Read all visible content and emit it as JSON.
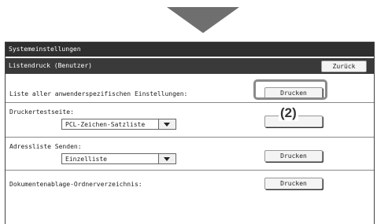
{
  "window": {
    "title": "Systemeinstellungen"
  },
  "header": {
    "title": "Listendruck (Benutzer)",
    "back_label": "Zurück"
  },
  "rows": [
    {
      "label": "Liste aller anwenderspezifischen Einstellungen:",
      "button_label": "Drucken"
    },
    {
      "label": "Druckertestseite:",
      "select_value": "PCL-Zeichen-Satzliste",
      "button_label": ""
    },
    {
      "label": "Adressliste Senden:",
      "select_value": "Einzelliste",
      "button_label": "Drucken"
    },
    {
      "label": "Dokumentenablage-Ordnerverzeichnis:",
      "button_label": "Drucken"
    }
  ],
  "annotation": {
    "callout": "(2)"
  }
}
